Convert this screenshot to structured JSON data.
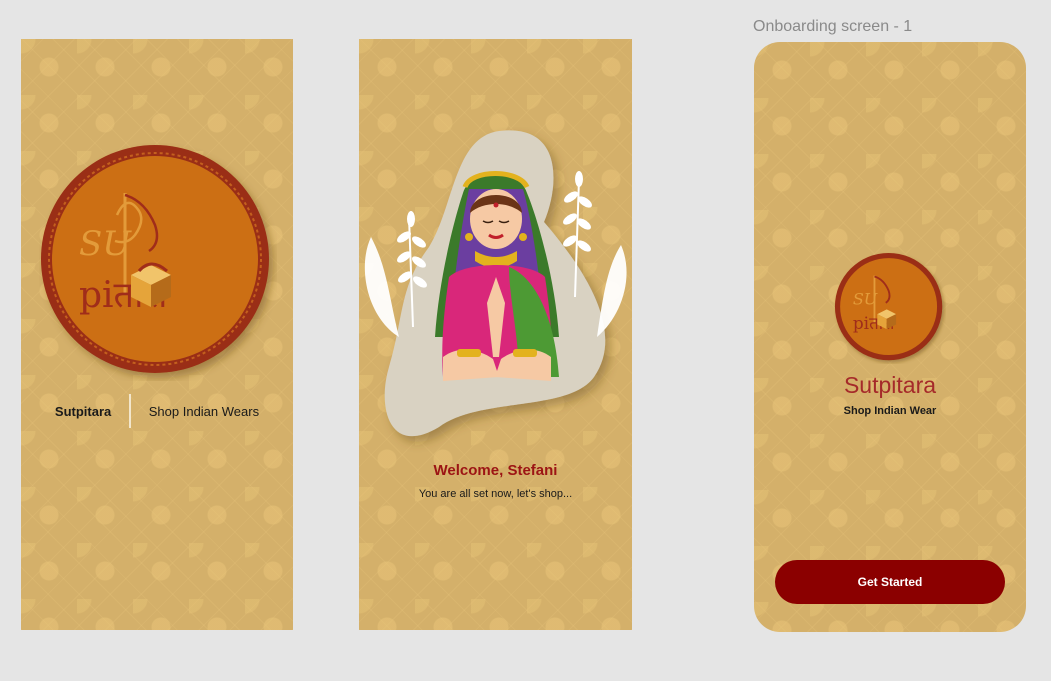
{
  "frame_label": "Onboarding screen - 1",
  "screen1": {
    "brand": "Sutpitara",
    "tagline": "Shop Indian Wears"
  },
  "screen2": {
    "welcome": "Welcome, Stefani",
    "subtitle": "You are all set now, let's shop..."
  },
  "screen3": {
    "brand": "Sutpitara",
    "tagline": "Shop Indian Wear",
    "cta_label": "Get Started"
  },
  "logo": {
    "top_text": "SU",
    "bottom_text": "piतारा"
  },
  "colors": {
    "background": "#e5e5e5",
    "frame": "#d4b06a",
    "logo_fill": "#cc6f14",
    "logo_ring": "#9a2f14",
    "accent_red": "#8b0000",
    "title_red": "#9c1414"
  }
}
